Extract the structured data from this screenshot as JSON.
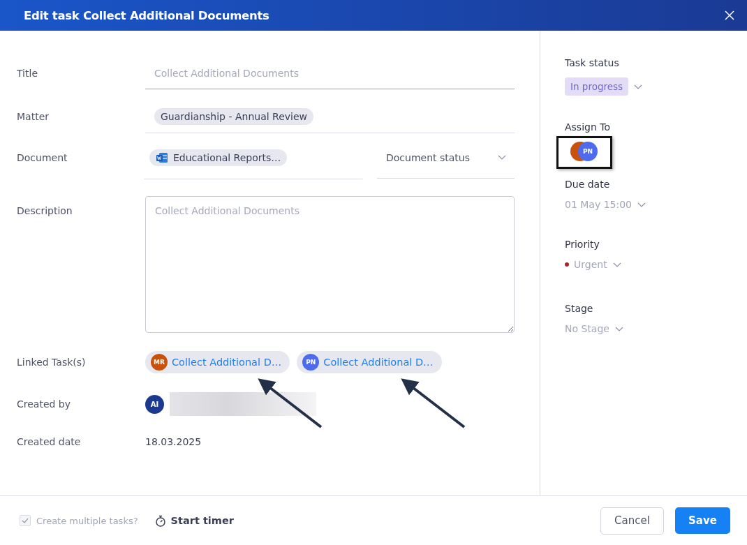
{
  "window": {
    "title": "Edit task Collect Additional Documents"
  },
  "form": {
    "title": {
      "label": "Title",
      "placeholder": "Collect Additional Documents"
    },
    "matter": {
      "label": "Matter",
      "value": "Guardianship - Annual Review"
    },
    "document": {
      "label": "Document",
      "value": "Educational Reports…",
      "status_placeholder": "Document status"
    },
    "description": {
      "label": "Description",
      "placeholder": "Collect Additional Documents"
    },
    "linked_tasks": {
      "label": "Linked Task(s)",
      "items": [
        {
          "initials": "MR",
          "color": "#c9510c",
          "title": "Collect Additional D…"
        },
        {
          "initials": "PN",
          "color": "#4f6bed",
          "title": "Collect Additional D…"
        }
      ]
    },
    "created_by": {
      "label": "Created by",
      "initials": "AI",
      "color": "#1b3a8f"
    },
    "created_date": {
      "label": "Created date",
      "value": "18.03.2025"
    }
  },
  "side": {
    "task_status": {
      "label": "Task status",
      "value": "In progress"
    },
    "assign_to": {
      "label": "Assign To",
      "avatars": [
        {
          "color": "#c9510c"
        },
        {
          "initials": "PN",
          "color": "#4f6bed"
        }
      ]
    },
    "due_date": {
      "label": "Due date",
      "value": "01 May 15:00"
    },
    "priority": {
      "label": "Priority",
      "value": "Urgent",
      "color": "#a4262c"
    },
    "stage": {
      "label": "Stage",
      "value": "No Stage"
    }
  },
  "footer": {
    "create_multiple": {
      "label": "Create multiple tasks?",
      "checked": true,
      "disabled": true
    },
    "start_timer": "Start timer",
    "cancel": "Cancel",
    "save": "Save"
  }
}
